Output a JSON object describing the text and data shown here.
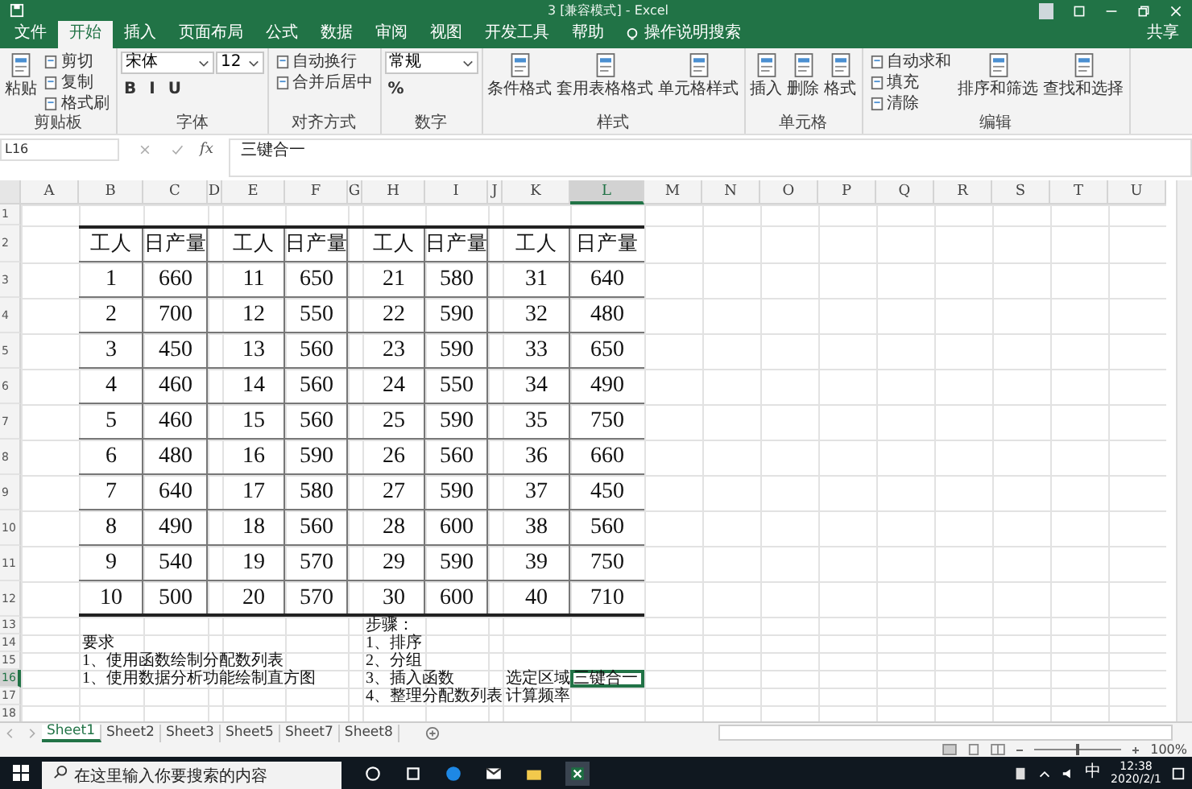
{
  "window": {
    "title": "3 [兼容模式] - Excel"
  },
  "ribbon_tabs": [
    {
      "label": "文件",
      "selected": false
    },
    {
      "label": "开始",
      "selected": true
    },
    {
      "label": "插入",
      "selected": false
    },
    {
      "label": "页面布局",
      "selected": false
    },
    {
      "label": "公式",
      "selected": false
    },
    {
      "label": "数据",
      "selected": false
    },
    {
      "label": "审阅",
      "selected": false
    },
    {
      "label": "视图",
      "selected": false
    },
    {
      "label": "开发工具",
      "selected": false
    },
    {
      "label": "帮助",
      "selected": false
    }
  ],
  "tell_me": "操作说明搜索",
  "share": "共享",
  "ribbon_groups": [
    {
      "label": "剪贴板",
      "columns": [
        [
          {
            "kind": "large",
            "label": "粘贴"
          }
        ],
        [
          {
            "kind": "small",
            "label": "剪切"
          },
          {
            "kind": "small",
            "label": "复制"
          },
          {
            "kind": "small",
            "label": "格式刷"
          }
        ]
      ]
    },
    {
      "label": "字体",
      "columns": [
        [
          {
            "kind": "field",
            "value": "宋体"
          },
          {
            "kind": "glyphs",
            "items": [
              "B",
              "I",
              "U"
            ]
          }
        ],
        [
          {
            "kind": "field",
            "value": "12"
          }
        ]
      ]
    },
    {
      "label": "对齐方式",
      "columns": [
        [
          {
            "kind": "small",
            "label": "自动换行"
          },
          {
            "kind": "small",
            "label": "合并后居中"
          }
        ]
      ]
    },
    {
      "label": "数字",
      "columns": [
        [
          {
            "kind": "field",
            "value": "常规"
          },
          {
            "kind": "glyphs",
            "items": [
              "%"
            ]
          }
        ]
      ]
    },
    {
      "label": "样式",
      "columns": [
        [
          {
            "kind": "large",
            "label": "条件格式"
          }
        ],
        [
          {
            "kind": "large",
            "label": "套用表格格式"
          }
        ],
        [
          {
            "kind": "large",
            "label": "单元格样式"
          }
        ]
      ]
    },
    {
      "label": "单元格",
      "columns": [
        [
          {
            "kind": "large",
            "label": "插入"
          }
        ],
        [
          {
            "kind": "large",
            "label": "删除"
          }
        ],
        [
          {
            "kind": "large",
            "label": "格式"
          }
        ]
      ]
    },
    {
      "label": "编辑",
      "columns": [
        [
          {
            "kind": "small",
            "label": "自动求和"
          },
          {
            "kind": "small",
            "label": "填充"
          },
          {
            "kind": "small",
            "label": "清除"
          }
        ],
        [
          {
            "kind": "large",
            "label": "排序和筛选"
          }
        ],
        [
          {
            "kind": "large",
            "label": "查找和选择"
          }
        ]
      ]
    }
  ],
  "formula_bar": {
    "name_box": "L16",
    "fx": "fx",
    "content": "三键合一"
  },
  "sheet": {
    "columns": [
      {
        "label": "A",
        "selected": false
      },
      {
        "label": "B",
        "selected": false
      },
      {
        "label": "C",
        "selected": false
      },
      {
        "label": "D",
        "selected": false
      },
      {
        "label": "E",
        "selected": false
      },
      {
        "label": "F",
        "selected": false
      },
      {
        "label": "G",
        "selected": false
      },
      {
        "label": "H",
        "selected": false
      },
      {
        "label": "I",
        "selected": false
      },
      {
        "label": "J",
        "selected": false
      },
      {
        "label": "K",
        "selected": false
      },
      {
        "label": "L",
        "selected": true
      },
      {
        "label": "M",
        "selected": false
      },
      {
        "label": "N",
        "selected": false
      },
      {
        "label": "O",
        "selected": false
      },
      {
        "label": "P",
        "selected": false
      },
      {
        "label": "Q",
        "selected": false
      },
      {
        "label": "R",
        "selected": false
      },
      {
        "label": "S",
        "selected": false
      },
      {
        "label": "T",
        "selected": false
      },
      {
        "label": "U",
        "selected": false
      }
    ],
    "rows": [
      {
        "number": "1",
        "selected": false
      },
      {
        "number": "2",
        "selected": false,
        "cells": {
          "B": "工人",
          "C": "日产量",
          "E": "工人",
          "F": "日产量",
          "H": "工人",
          "I": "日产量",
          "K": "工人",
          "L": "日产量"
        }
      },
      {
        "number": "3",
        "selected": false,
        "cells": {
          "B": "1",
          "C": "660",
          "E": "11",
          "F": "650",
          "H": "21",
          "I": "580",
          "K": "31",
          "L": "640"
        }
      },
      {
        "number": "4",
        "selected": false,
        "cells": {
          "B": "2",
          "C": "700",
          "E": "12",
          "F": "550",
          "H": "22",
          "I": "590",
          "K": "32",
          "L": "480"
        }
      },
      {
        "number": "5",
        "selected": false,
        "cells": {
          "B": "3",
          "C": "450",
          "E": "13",
          "F": "560",
          "H": "23",
          "I": "590",
          "K": "33",
          "L": "650"
        }
      },
      {
        "number": "6",
        "selected": false,
        "cells": {
          "B": "4",
          "C": "460",
          "E": "14",
          "F": "560",
          "H": "24",
          "I": "550",
          "K": "34",
          "L": "490"
        }
      },
      {
        "number": "7",
        "selected": false,
        "cells": {
          "B": "5",
          "C": "460",
          "E": "15",
          "F": "560",
          "H": "25",
          "I": "590",
          "K": "35",
          "L": "750"
        }
      },
      {
        "number": "8",
        "selected": false,
        "cells": {
          "B": "6",
          "C": "480",
          "E": "16",
          "F": "590",
          "H": "26",
          "I": "560",
          "K": "36",
          "L": "660"
        }
      },
      {
        "number": "9",
        "selected": false,
        "cells": {
          "B": "7",
          "C": "640",
          "E": "17",
          "F": "580",
          "H": "27",
          "I": "590",
          "K": "37",
          "L": "450"
        }
      },
      {
        "number": "10",
        "selected": false,
        "cells": {
          "B": "8",
          "C": "490",
          "E": "18",
          "F": "560",
          "H": "28",
          "I": "600",
          "K": "38",
          "L": "560"
        }
      },
      {
        "number": "11",
        "selected": false,
        "cells": {
          "B": "9",
          "C": "540",
          "E": "19",
          "F": "570",
          "H": "29",
          "I": "590",
          "K": "39",
          "L": "750"
        }
      },
      {
        "number": "12",
        "selected": false,
        "cells": {
          "B": "10",
          "C": "500",
          "E": "20",
          "F": "570",
          "H": "30",
          "I": "600",
          "K": "40",
          "L": "710"
        }
      },
      {
        "number": "13",
        "selected": false,
        "cells": {
          "H": "步骤："
        }
      },
      {
        "number": "14",
        "selected": false,
        "cells": {
          "B": "要求",
          "H": "1、排序"
        }
      },
      {
        "number": "15",
        "selected": false,
        "cells": {
          "B": "1、使用函数绘制分配数列表",
          "H": "2、分组"
        }
      },
      {
        "number": "16",
        "selected": true,
        "cells": {
          "B": "1、使用数据分析功能绘制直方图",
          "H": "3、插入函数",
          "K": "选定区域",
          "L": "三键合一"
        }
      },
      {
        "number": "17",
        "selected": false,
        "cells": {
          "H": "4、整理分配数列表",
          "K": "计算频率"
        }
      },
      {
        "number": "18",
        "selected": false
      }
    ]
  },
  "sheet_tabs": [
    {
      "label": "Sheet1",
      "selected": true
    },
    {
      "label": "Sheet2",
      "selected": false
    },
    {
      "label": "Sheet3",
      "selected": false
    },
    {
      "label": "Sheet5",
      "selected": false
    },
    {
      "label": "Sheet7",
      "selected": false
    },
    {
      "label": "Sheet8",
      "selected": false
    }
  ],
  "status_bar": {
    "zoom": {
      "level": 0.5,
      "reading": "100%"
    }
  },
  "taskbar": {
    "search_placeholder": "在这里输入你要搜索的内容",
    "ime": "中",
    "time": "12:38",
    "date": "2020/2/1"
  }
}
